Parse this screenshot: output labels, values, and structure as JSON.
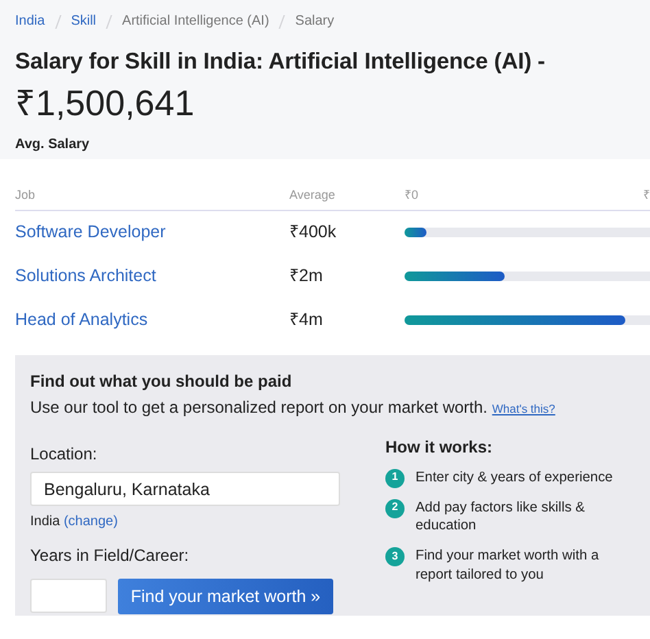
{
  "breadcrumb": [
    {
      "label": "India",
      "link": true
    },
    {
      "label": "Skill",
      "link": true
    },
    {
      "label": "Artificial Intelligence (AI)",
      "link": false
    },
    {
      "label": "Salary",
      "link": false
    }
  ],
  "title": "Salary for Skill in India: Artificial Intelligence (AI) -",
  "average_salary": {
    "value": "₹1,500,641",
    "label": "Avg. Salary"
  },
  "jobs_table": {
    "columns": [
      "Job",
      "Average",
      "₹0",
      "₹"
    ],
    "rows": [
      {
        "job": "Software Developer",
        "average": "₹400k",
        "level": 0.09
      },
      {
        "job": "Solutions Architect",
        "average": "₹2m",
        "level": 0.41
      },
      {
        "job": "Head of Analytics",
        "average": "₹4m",
        "level": 0.9
      }
    ]
  },
  "pay_tool": {
    "heading": "Find out what you should be paid",
    "description": "Use our tool to get a personalized report on your market worth.",
    "help_link": "What's this?",
    "location_label": "Location:",
    "location_value": "Bengaluru, Karnataka",
    "country": "India",
    "change_link": "(change)",
    "years_label": "Years in Field/Career:",
    "button": "Find your market worth »",
    "how_heading": "How it works:",
    "steps": [
      {
        "number": "1",
        "text": "Enter city & years of experience"
      },
      {
        "number": "2",
        "text": "Add pay factors like skills & education"
      },
      {
        "number": "3",
        "text": "Find your market worth with a report tailored to you"
      }
    ]
  }
}
